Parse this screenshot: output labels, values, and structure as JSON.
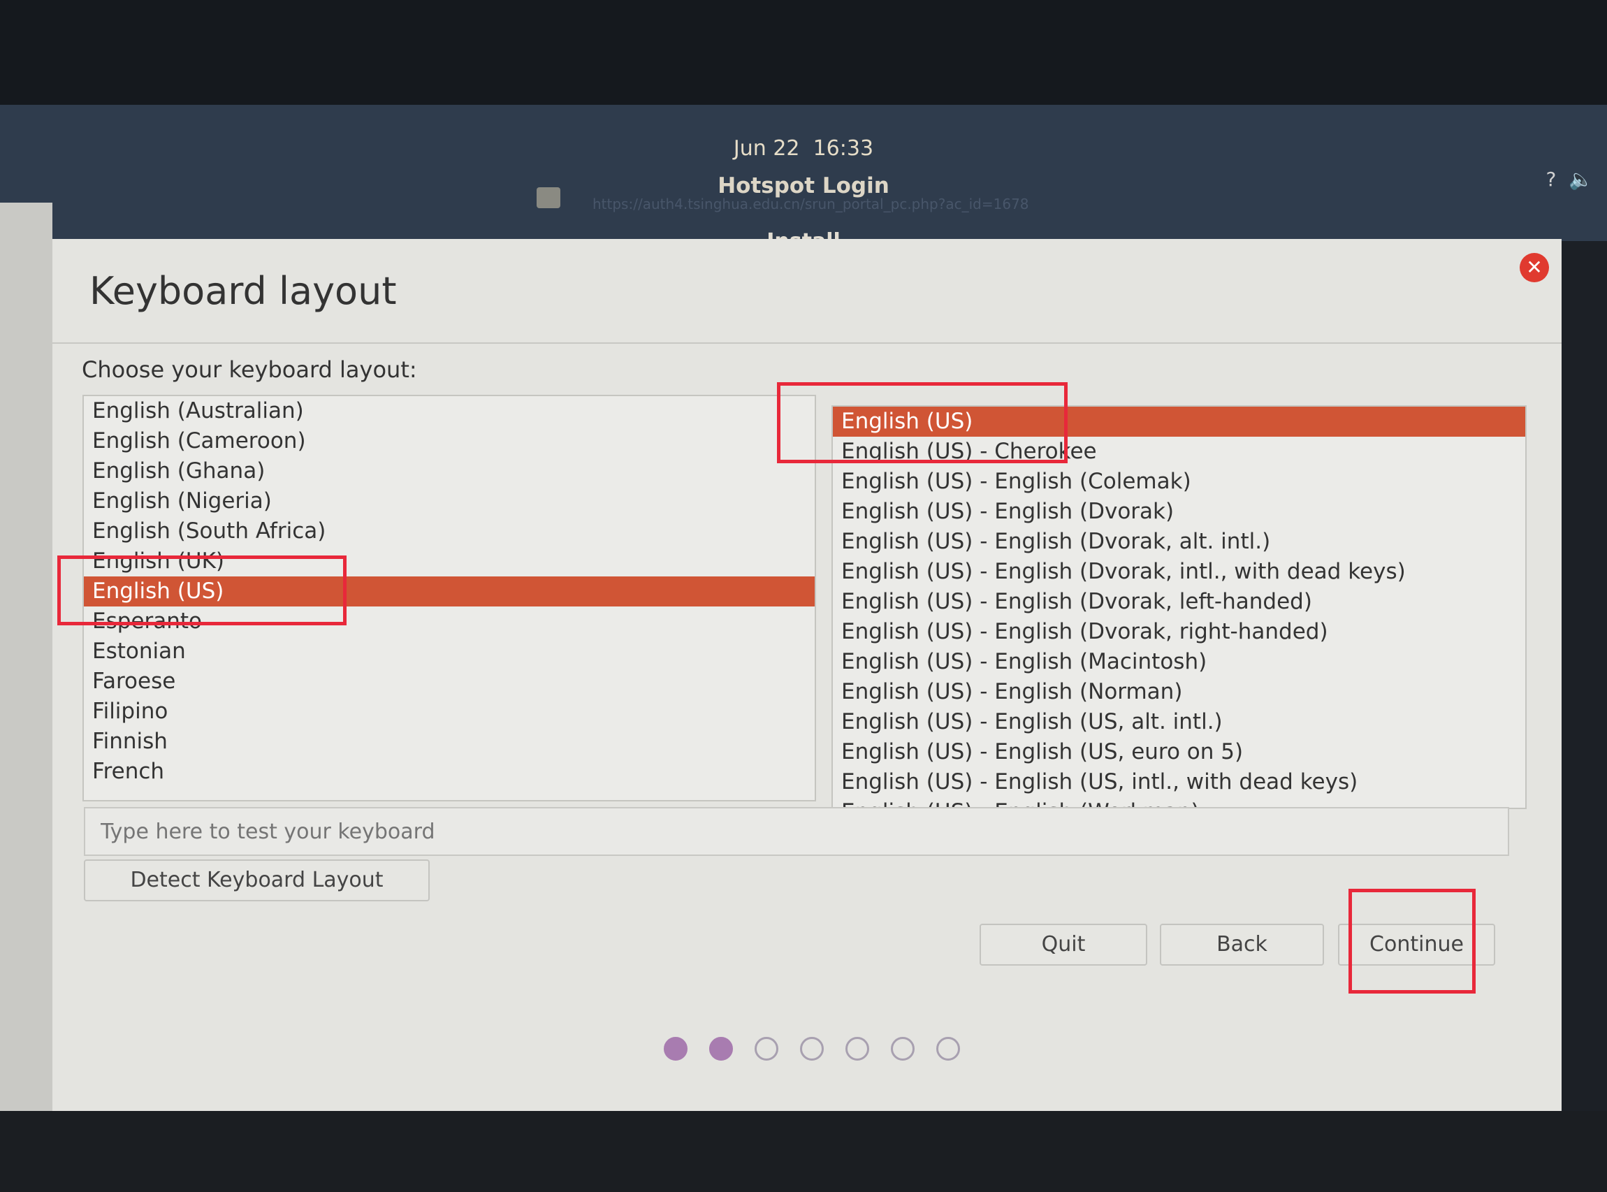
{
  "panel": {
    "date": "Jun 22",
    "time": "16:33",
    "hotspot_title": "Hotspot Login",
    "url": "https://auth4.tsinghua.edu.cn/srun_portal_pc.php?ac_id=1678",
    "icons": [
      "help-icon",
      "volume-icon"
    ]
  },
  "window": {
    "title": "Install",
    "close_icon": "close-icon"
  },
  "page": {
    "heading": "Keyboard layout",
    "prompt": "Choose your keyboard layout:"
  },
  "layouts": [
    "English (Australian)",
    "English (Cameroon)",
    "English (Ghana)",
    "English (Nigeria)",
    "English (South Africa)",
    "English (UK)",
    "English (US)",
    "Esperanto",
    "Estonian",
    "Faroese",
    "Filipino",
    "Finnish",
    "French"
  ],
  "layouts_selected": "English (US)",
  "variants": [
    "English (US)",
    "English (US) - Cherokee",
    "English (US) - English (Colemak)",
    "English (US) - English (Dvorak)",
    "English (US) - English (Dvorak, alt. intl.)",
    "English (US) - English (Dvorak, intl., with dead keys)",
    "English (US) - English (Dvorak, left-handed)",
    "English (US) - English (Dvorak, right-handed)",
    "English (US) - English (Macintosh)",
    "English (US) - English (Norman)",
    "English (US) - English (US, alt. intl.)",
    "English (US) - English (US, euro on 5)",
    "English (US) - English (US, intl., with dead keys)",
    "English (US) - English (Workman)"
  ],
  "variants_selected": "English (US)",
  "test_input": {
    "placeholder": "Type here to test your keyboard",
    "value": ""
  },
  "buttons": {
    "detect": "Detect Keyboard Layout",
    "quit": "Quit",
    "back": "Back",
    "continue": "Continue"
  },
  "progress": {
    "current_step": 2,
    "total_steps": 7
  },
  "colors": {
    "selection": "#d05535",
    "annotation": "#e8283a",
    "progress_dot": "#a87cb0"
  }
}
